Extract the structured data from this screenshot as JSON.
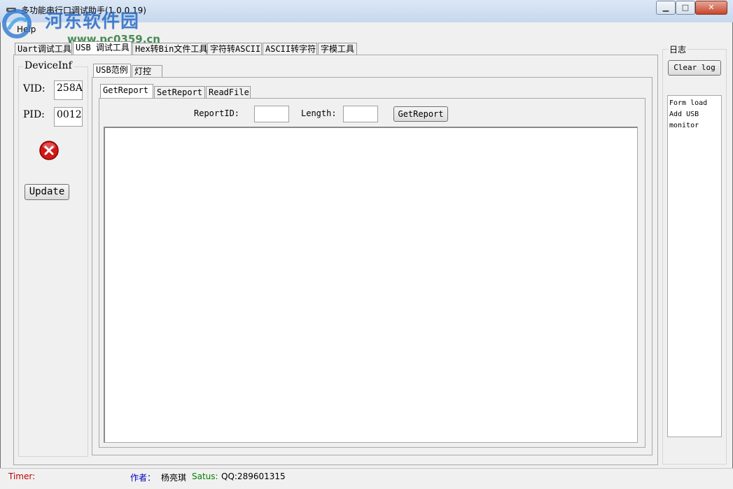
{
  "window": {
    "title": "多功能串行口调试助手(1.0.0.19)",
    "controls": {
      "minimize": "▁",
      "maximize": "□",
      "close": "✕"
    }
  },
  "watermark": {
    "name": "河东软件园",
    "url": "www.pc0359.cn"
  },
  "menu": {
    "help": "Help"
  },
  "tabs": [
    {
      "label": "Uart调试工具"
    },
    {
      "label": "USB 调试工具"
    },
    {
      "label": "Hex转Bin文件工具"
    },
    {
      "label": "字符转ASCII"
    },
    {
      "label": "ASCII转字符"
    },
    {
      "label": "字模工具"
    }
  ],
  "device": {
    "group_title": "DeviceInf",
    "vid_label": "VID:",
    "vid_value": "258A",
    "pid_label": "PID:",
    "pid_value": "0012",
    "status_icon": "error-icon",
    "update_label": "Update"
  },
  "subtabs": [
    {
      "label": "USB范例"
    },
    {
      "label": "灯控"
    }
  ],
  "report_tabs": [
    {
      "label": "GetReport"
    },
    {
      "label": "SetReport"
    },
    {
      "label": "ReadFile"
    }
  ],
  "report": {
    "report_id_label": "ReportID:",
    "report_id_value": "",
    "length_label": "Length:",
    "length_value": "",
    "get_button": "GetReport"
  },
  "log": {
    "group_title": "日志",
    "clear_label": "Clear log",
    "lines": [
      "Form load",
      "Add USB",
      "monitor"
    ]
  },
  "status": {
    "timer_label": "Timer:",
    "author_label": "作者：",
    "author_name": "杨亮琪",
    "status_label": "Satus:",
    "qq": "QQ:289601315"
  },
  "colors": {
    "timer": "#c00000",
    "author": "#0000c0",
    "status": "#008000"
  }
}
